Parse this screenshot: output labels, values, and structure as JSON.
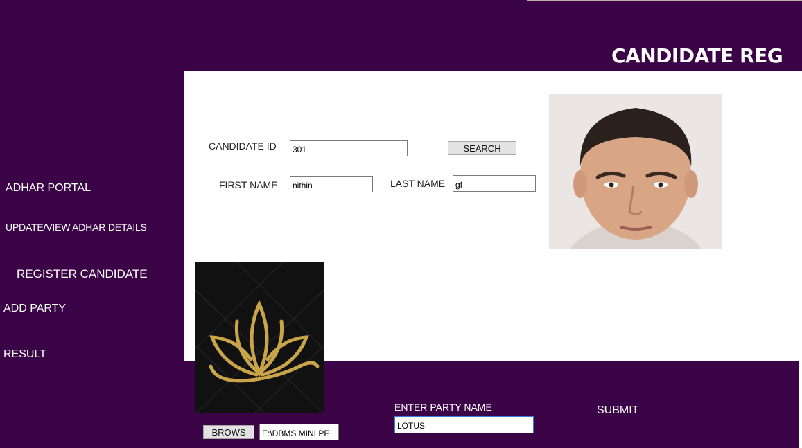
{
  "header": {
    "title": "CANDIDATE REG"
  },
  "sidebar": {
    "items": [
      {
        "label": "ADHAR PORTAL"
      },
      {
        "label": "UPDATE/VIEW ADHAR DETAILS"
      },
      {
        "label": "REGISTER CANDIDATE"
      },
      {
        "label": "ADD PARTY"
      },
      {
        "label": "RESULT"
      }
    ]
  },
  "form": {
    "candidate_id_label": "CANDIDATE ID",
    "candidate_id_value": "301",
    "search_label": "SEARCH",
    "first_name_label": "FIRST NAME",
    "first_name_value": "nithin",
    "last_name_label": "LAST NAME",
    "last_name_value": "gf"
  },
  "party": {
    "browse_label": "BROWS",
    "file_path_value": "E:\\DBMS MINI PF",
    "party_name_label": "ENTER PARTY NAME",
    "party_name_value": "LOTUS",
    "submit_label": "SUBMIT"
  },
  "colors": {
    "background": "#3a0447",
    "panel": "#ffffff",
    "logo_gold": "#c9a449"
  },
  "icons": {
    "candidate_photo": "person-photo",
    "party_logo": "lotus-logo"
  }
}
